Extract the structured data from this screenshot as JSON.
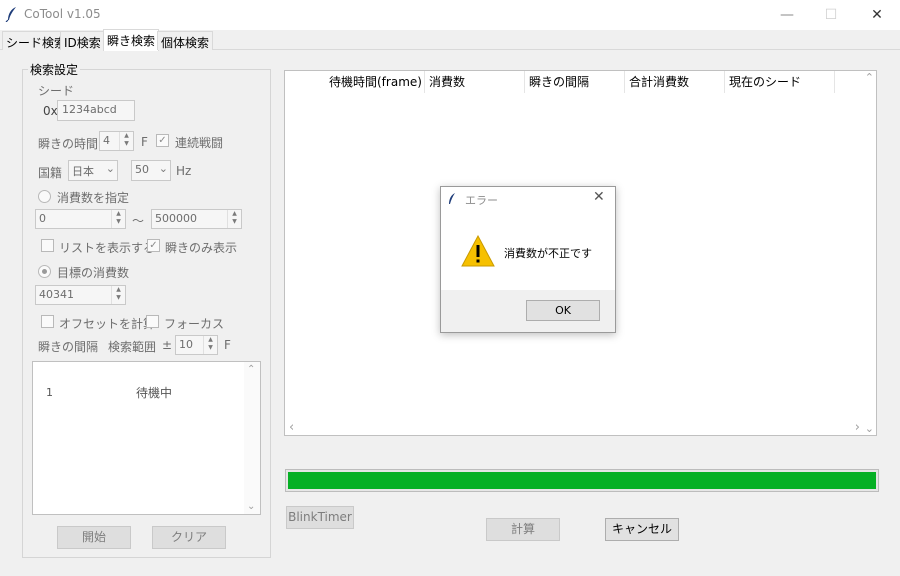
{
  "window": {
    "title": "CoTool v1.05",
    "minimize": "—",
    "maximize": "☐",
    "close": "✕"
  },
  "tabs": [
    "シード検索",
    "ID検索",
    "瞬き検索",
    "個体検索"
  ],
  "search_settings": {
    "legend": "検索設定",
    "seed_label": "シード",
    "seed_prefix": "0x",
    "seed_value": "1234abcd",
    "blink_time_label": "瞬きの時間",
    "blink_time_value": "4",
    "blink_time_unit": "F",
    "continuous_battle_label": "連続戦闘",
    "continuous_battle_checked": true,
    "nationality_label": "国籍",
    "nationality_value": "日本",
    "hz_value": "50",
    "hz_unit": "Hz",
    "consumption_specify_label": "消費数を指定",
    "range_min": "0",
    "range_sep": "〜",
    "range_max": "500000",
    "show_list_label": "リストを表示する",
    "blink_only_label": "瞬きのみ表示",
    "blink_only_checked": true,
    "target_consumption_label": "目標の消費数",
    "target_consumption_value": "40341",
    "calc_offset_label": "オフセットを計算",
    "focus_label": "フォーカス",
    "blink_interval_label": "瞬きの間隔",
    "search_range_label": "検索範囲",
    "search_range_pm": "±",
    "search_range_value": "10",
    "search_range_unit": "F",
    "list_rows": [
      {
        "index": "1",
        "status": "待機中"
      }
    ],
    "start_button": "開始",
    "clear_button": "クリア"
  },
  "results": {
    "columns": [
      "待機時間(frame)",
      "消費数",
      "瞬きの間隔",
      "合計消費数",
      "現在のシード"
    ],
    "scroll_left": "‹",
    "scroll_right": "›"
  },
  "progress": {
    "value": 1.0,
    "color": "#06b025"
  },
  "buttons": {
    "blink_timer": "BlinkTimer",
    "calculate": "計算",
    "cancel": "キャンセル"
  },
  "dialog": {
    "title": "エラー",
    "message": "消費数が不正です",
    "ok": "OK",
    "close": "✕",
    "icon": "warning-icon"
  }
}
